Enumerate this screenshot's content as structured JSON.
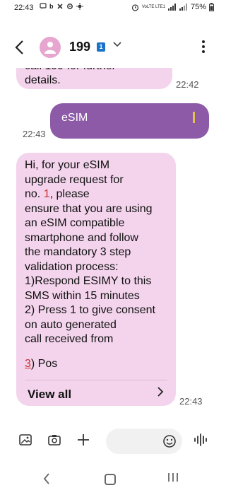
{
  "status_bar": {
    "time": "22:43",
    "left_icons": [
      "message-icon",
      "b-icon",
      "x-icon",
      "gear-icon",
      "sun-icon"
    ],
    "network": "VoLTE LTE1",
    "battery": "75%"
  },
  "header": {
    "contact_name": "199",
    "sim_badge": "1"
  },
  "messages": [
    {
      "direction": "incoming",
      "partial_text": "call 199 for further",
      "text": "details.",
      "time": "22:42"
    },
    {
      "direction": "outgoing",
      "text": "eSIM",
      "time": "22:43"
    },
    {
      "direction": "incoming",
      "text_before_no": "Hi, for your eSIM\nupgrade request for\nno. ",
      "redacted_digit": "1",
      "text_after_no": ", please\nensure that you are using\nan eSIM compatible\nsmartphone and follow\nthe mandatory 3 step\nvalidation process:\n1)Respond ESIMY to this\nSMS within 15 minutes\n2) Press 1 to give consent\non auto generated\ncall received from",
      "last_line_num": "3",
      "last_line_rest": ") Pos",
      "view_all": "View all",
      "time": "22:43"
    }
  ],
  "composer": {
    "tools": [
      "gallery-icon",
      "camera-icon",
      "plus-icon"
    ],
    "emoji": "emoji-icon",
    "voice": "voice-icon"
  }
}
